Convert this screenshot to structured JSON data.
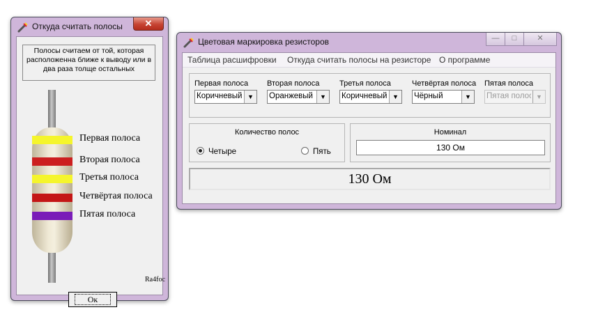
{
  "help_window": {
    "title": "Откуда считать полосы",
    "close_label": "✕",
    "info_text": "Полосы считаем от той, которая расположенна ближе к выводу или в два раза толще остальных",
    "band_labels": [
      "Первая полоса",
      "Вторая полоса",
      "Третья полоса",
      "Четвёртая полоса",
      "Пятая полоса"
    ],
    "band_colors": [
      "#f5f52c",
      "#cc1f1f",
      "#f5f52c",
      "#c41616",
      "#7a1cb8"
    ],
    "signature": "Ra4foc",
    "ok_label": "Ок"
  },
  "main_window": {
    "title": "Цветовая маркировка резисторов",
    "buttons": {
      "minimize": "—",
      "maximize": "□",
      "close": "✕"
    },
    "menu": [
      "Таблица расшифровки",
      "Откуда считать полосы на резисторе",
      "О программе"
    ],
    "bands": [
      {
        "label": "Первая полоса",
        "value": "Коричневый",
        "enabled": true
      },
      {
        "label": "Вторая полоса",
        "value": "Оранжевый",
        "enabled": true
      },
      {
        "label": "Третья полоса",
        "value": "Коричневый",
        "enabled": true
      },
      {
        "label": "Четвёртая полоса",
        "value": "Чёрный",
        "enabled": true
      },
      {
        "label": "Пятая полоса",
        "value": "Пятая полоса",
        "enabled": false
      }
    ],
    "band_count": {
      "title": "Количество полос",
      "options": [
        {
          "label": "Четыре",
          "selected": true
        },
        {
          "label": "Пять",
          "selected": false
        }
      ]
    },
    "nominal": {
      "label": "Номинал",
      "value": "130 Ом"
    },
    "result": "130 Ом"
  },
  "colors": {
    "window_frame": "#cfb6da",
    "close_button": "#c64433",
    "client_bg": "#f0f0f0"
  }
}
